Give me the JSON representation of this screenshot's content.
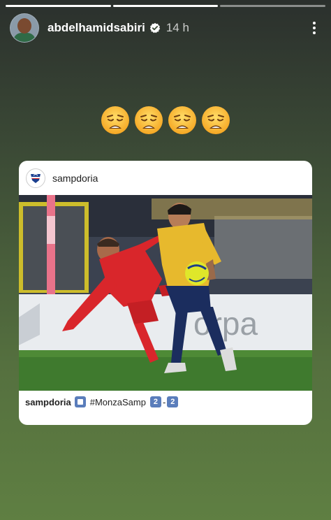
{
  "story": {
    "segments": [
      {
        "state": "done"
      },
      {
        "state": "done"
      },
      {
        "state": "current"
      }
    ],
    "username": "abdelhamidsabiri",
    "time": "14 h",
    "emoji_count": 4,
    "emoji_name": "weary-face"
  },
  "shared_post": {
    "account": "sampdoria",
    "caption_user": "sampdoria",
    "hashtag": "#MonzaSamp",
    "score_home": "2",
    "score_sep": "-",
    "score_away": "2",
    "photo_ad_text": "orpa"
  },
  "colors": {
    "background_top": "#2b302d",
    "background_bottom": "#5f7f42",
    "verified_blue": "#3897f0",
    "chip_blue": "#5a7dbb"
  }
}
